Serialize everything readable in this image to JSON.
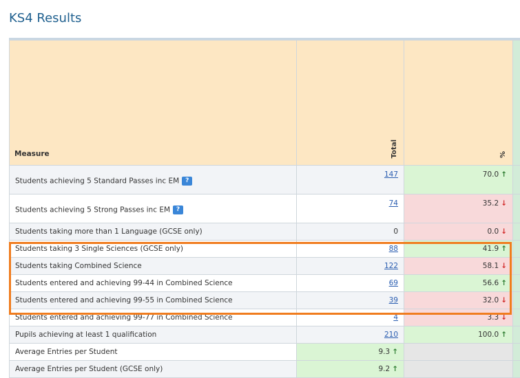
{
  "page": {
    "title": "KS4 Results"
  },
  "table": {
    "headers": {
      "measure": "Measure",
      "total": "Total",
      "percent": "%"
    },
    "rows": [
      {
        "measure": "Students achieving 5 Standard Passes inc EM",
        "help": "?",
        "total": "147",
        "total_link": true,
        "percent": "70.0",
        "percent_trend": "↑",
        "percent_status": "green"
      },
      {
        "measure": "Students achieving 5 Strong Passes inc EM",
        "help": "?",
        "total": "74",
        "total_link": true,
        "percent": "35.2",
        "percent_trend": "↓",
        "percent_status": "red"
      },
      {
        "measure": "Students taking more than 1 Language (GCSE only)",
        "total": "0",
        "total_link": false,
        "percent": "0.0",
        "percent_trend": "↓",
        "percent_status": "red"
      },
      {
        "measure": "Students taking 3 Single Sciences (GCSE only)",
        "total": "88",
        "total_link": true,
        "percent": "41.9",
        "percent_trend": "↑",
        "percent_status": "green"
      },
      {
        "measure": "Students taking Combined Science",
        "total": "122",
        "total_link": true,
        "percent": "58.1",
        "percent_trend": "↓",
        "percent_status": "red"
      },
      {
        "measure": "Students entered and achieving 99-44 in Combined Science",
        "total": "69",
        "total_link": true,
        "percent": "56.6",
        "percent_trend": "↑",
        "percent_status": "green"
      },
      {
        "measure": "Students entered and achieving 99-55 in Combined Science",
        "total": "39",
        "total_link": true,
        "percent": "32.0",
        "percent_trend": "↓",
        "percent_status": "red"
      },
      {
        "measure": "Students entered and achieving 99-77 in Combined Science",
        "total": "4",
        "total_link": true,
        "percent": "3.3",
        "percent_trend": "↓",
        "percent_status": "red"
      },
      {
        "measure": "Pupils achieving at least 1 qualification",
        "total": "210",
        "total_link": true,
        "percent": "100.0",
        "percent_trend": "↑",
        "percent_status": "green"
      },
      {
        "measure": "Average Entries per Student",
        "total": "9.3",
        "total_trend": "↑",
        "total_link": false,
        "total_status": "green",
        "percent": "",
        "percent_status": "grey"
      },
      {
        "measure": "Average Entries per Student (GCSE only)",
        "total": "9.2",
        "total_trend": "↑",
        "total_link": false,
        "total_status": "green",
        "percent": "",
        "percent_status": "grey"
      }
    ]
  },
  "colors": {
    "header_bg": "#fde7c3",
    "green_cell": "#daf5d4",
    "red_cell": "#f8d9da",
    "grey_cell": "#e6e6e6",
    "highlight_border": "#f07c1e",
    "trend_up": "#2e7d32",
    "trend_down": "#d32f2f"
  },
  "icons": {
    "help": "help-icon",
    "trend_up": "arrow-up-icon",
    "trend_down": "arrow-down-icon"
  }
}
